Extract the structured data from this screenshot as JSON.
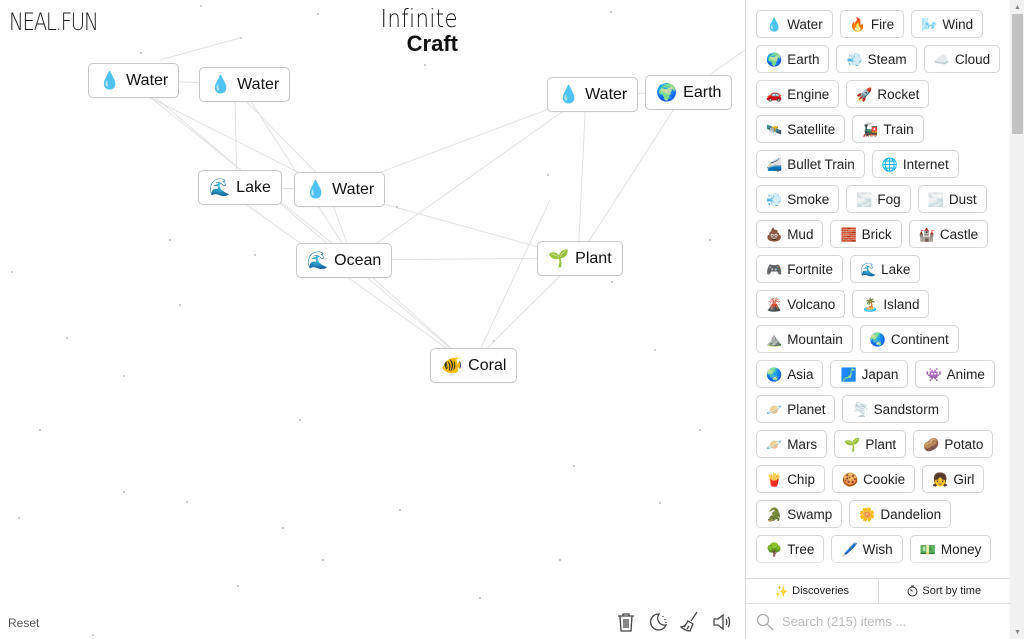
{
  "logo": "NEAL.FUN",
  "title": {
    "line1": "Infinite",
    "line2": "Craft"
  },
  "canvas_nodes": [
    {
      "emoji": "💧",
      "label": "Water"
    },
    {
      "emoji": "💧",
      "label": "Water"
    },
    {
      "emoji": "🌊",
      "label": "Lake"
    },
    {
      "emoji": "💧",
      "label": "Water"
    },
    {
      "emoji": "🌊",
      "label": "Ocean"
    },
    {
      "emoji": "💧",
      "label": "Water"
    },
    {
      "emoji": "🌍",
      "label": "Earth"
    },
    {
      "emoji": "🌱",
      "label": "Plant"
    },
    {
      "emoji": "🐠",
      "label": "Coral"
    }
  ],
  "reset_label": "Reset",
  "tools": [
    "trash-icon",
    "moon-icon",
    "broom-icon",
    "sound-icon"
  ],
  "sidebar": {
    "items": [
      {
        "emoji": "💧",
        "label": "Water"
      },
      {
        "emoji": "🔥",
        "label": "Fire"
      },
      {
        "emoji": "🌬️",
        "label": "Wind"
      },
      {
        "emoji": "🌍",
        "label": "Earth"
      },
      {
        "emoji": "💨",
        "label": "Steam"
      },
      {
        "emoji": "☁️",
        "label": "Cloud"
      },
      {
        "emoji": "🚗",
        "label": "Engine"
      },
      {
        "emoji": "🚀",
        "label": "Rocket"
      },
      {
        "emoji": "🛰️",
        "label": "Satellite"
      },
      {
        "emoji": "🚂",
        "label": "Train"
      },
      {
        "emoji": "🚄",
        "label": "Bullet Train"
      },
      {
        "emoji": "🌐",
        "label": "Internet"
      },
      {
        "emoji": "💨",
        "label": "Smoke"
      },
      {
        "emoji": "🌫️",
        "label": "Fog"
      },
      {
        "emoji": "🌫️",
        "label": "Dust"
      },
      {
        "emoji": "💩",
        "label": "Mud"
      },
      {
        "emoji": "🧱",
        "label": "Brick"
      },
      {
        "emoji": "🏰",
        "label": "Castle"
      },
      {
        "emoji": "🎮",
        "label": "Fortnite"
      },
      {
        "emoji": "🌊",
        "label": "Lake"
      },
      {
        "emoji": "🌋",
        "label": "Volcano"
      },
      {
        "emoji": "🏝️",
        "label": "Island"
      },
      {
        "emoji": "⛰️",
        "label": "Mountain"
      },
      {
        "emoji": "🌏",
        "label": "Continent"
      },
      {
        "emoji": "🌏",
        "label": "Asia"
      },
      {
        "emoji": "🗾",
        "label": "Japan"
      },
      {
        "emoji": "👾",
        "label": "Anime"
      },
      {
        "emoji": "🪐",
        "label": "Planet"
      },
      {
        "emoji": "🌪️",
        "label": "Sandstorm"
      },
      {
        "emoji": "🪐",
        "label": "Mars"
      },
      {
        "emoji": "🌱",
        "label": "Plant"
      },
      {
        "emoji": "🥔",
        "label": "Potato"
      },
      {
        "emoji": "🍟",
        "label": "Chip"
      },
      {
        "emoji": "🍪",
        "label": "Cookie"
      },
      {
        "emoji": "👧",
        "label": "Girl"
      },
      {
        "emoji": "🐊",
        "label": "Swamp"
      },
      {
        "emoji": "🌼",
        "label": "Dandelion"
      },
      {
        "emoji": "🌳",
        "label": "Tree"
      },
      {
        "emoji": "🖊️",
        "label": "Wish"
      },
      {
        "emoji": "💵",
        "label": "Money"
      }
    ],
    "discoveries_label": "Discoveries",
    "sort_label": "Sort by time",
    "search_placeholder": "Search (215) items ..."
  }
}
